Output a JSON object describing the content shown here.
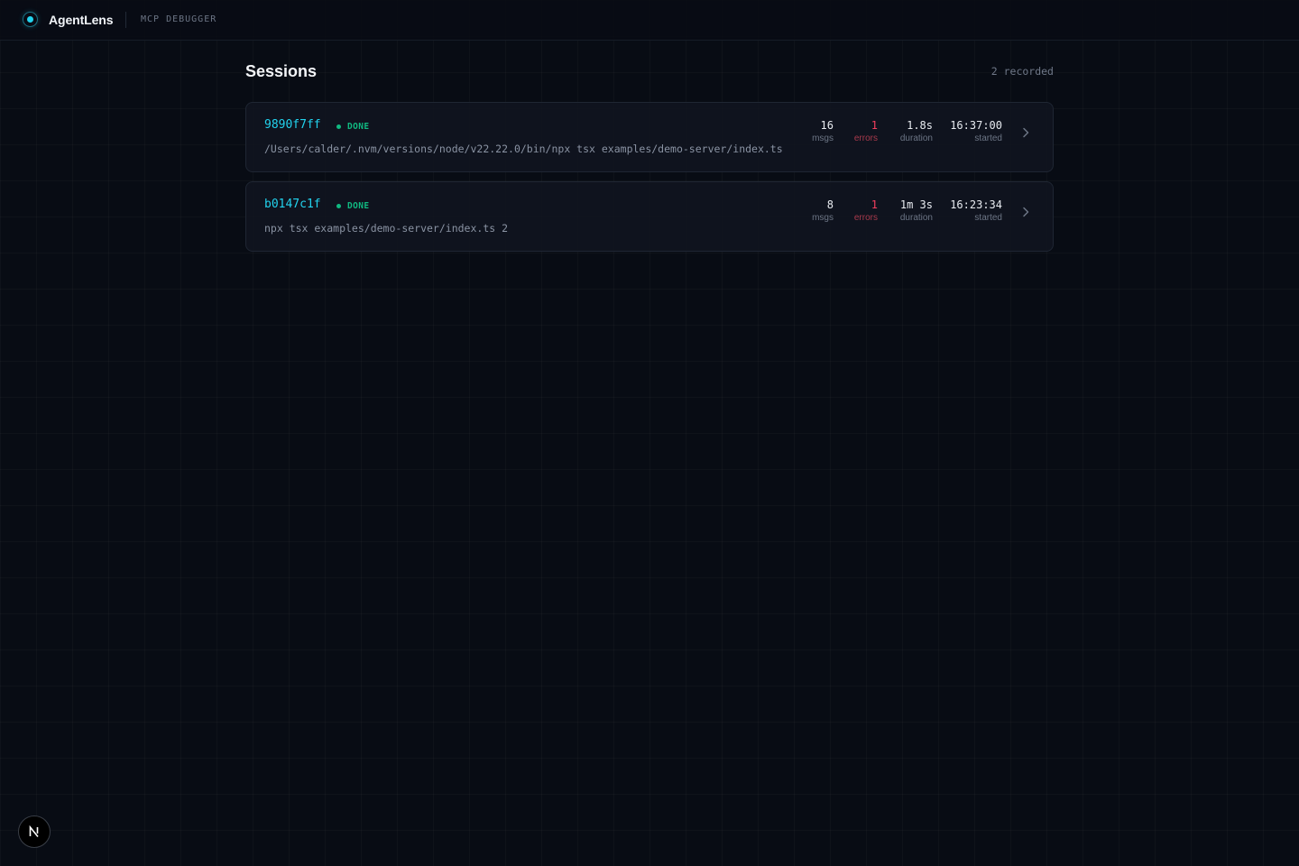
{
  "header": {
    "brand": "AgentLens",
    "subtitle": "MCP DEBUGGER"
  },
  "page": {
    "title": "Sessions",
    "count": "2 recorded"
  },
  "sessions": [
    {
      "id": "9890f7ff",
      "status": "DONE",
      "command": "/Users/calder/.nvm/versions/node/v22.22.0/bin/npx tsx examples/demo-server/index.ts",
      "msgs": "16",
      "msgs_label": "msgs",
      "errors": "1",
      "errors_label": "errors",
      "duration": "1.8s",
      "duration_label": "duration",
      "started": "16:37:00",
      "started_label": "started"
    },
    {
      "id": "b0147c1f",
      "status": "DONE",
      "command": "npx tsx examples/demo-server/index.ts 2",
      "msgs": "8",
      "msgs_label": "msgs",
      "errors": "1",
      "errors_label": "errors",
      "duration": "1m 3s",
      "duration_label": "duration",
      "started": "16:23:34",
      "started_label": "started"
    }
  ],
  "colors": {
    "accent": "#22d3ee",
    "success": "#10b981",
    "error": "#f43f5e",
    "background": "#080c14"
  },
  "icons": {
    "logo": "lens-logo-icon",
    "row_arrow": "chevron-right-icon",
    "dev_badge": "nextjs-icon"
  }
}
